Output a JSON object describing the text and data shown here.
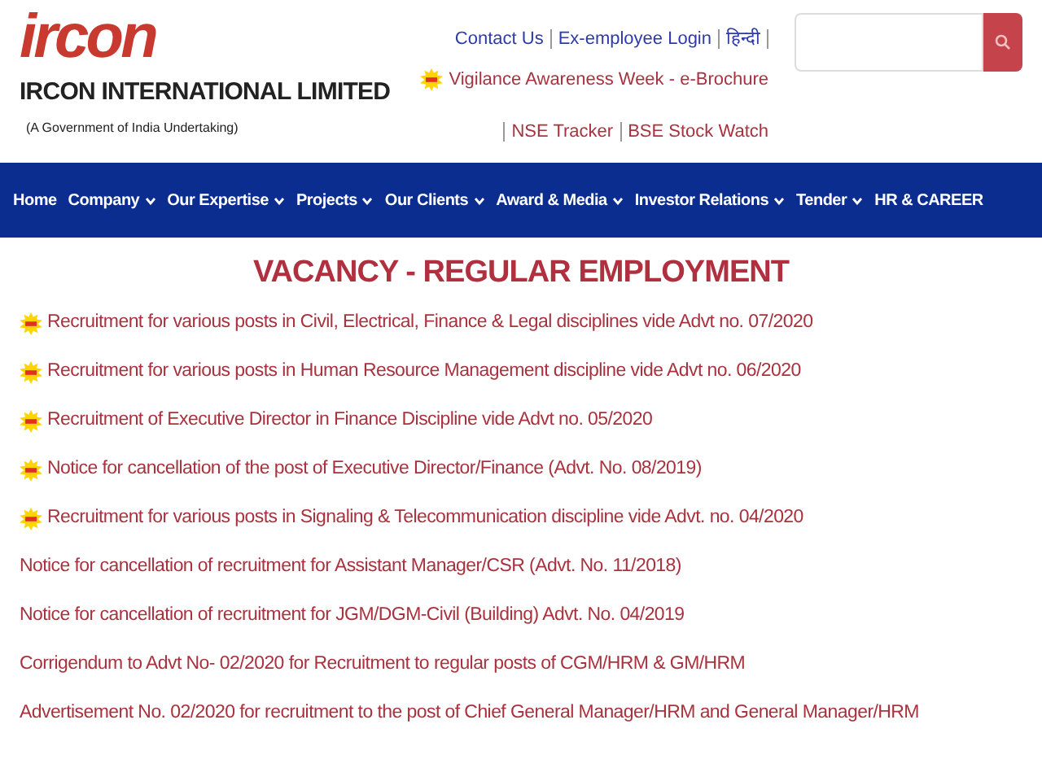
{
  "header": {
    "logo": "ircon",
    "company": "IRCON INTERNATIONAL LIMITED",
    "tagline": "(A Government of India Undertaking)",
    "top_links": [
      {
        "label": "Contact Us"
      },
      {
        "label": "Ex-employee Login"
      },
      {
        "label": "हिन्दी"
      }
    ],
    "vigilance": {
      "label": "Vigilance Awareness Week - e-Brochure",
      "new": true
    },
    "market_links": [
      {
        "label": "NSE Tracker"
      },
      {
        "label": "BSE Stock Watch"
      }
    ]
  },
  "nav": [
    {
      "label": "Home",
      "dropdown": false
    },
    {
      "label": "Company",
      "dropdown": true
    },
    {
      "label": "Our Expertise",
      "dropdown": true
    },
    {
      "label": "Projects",
      "dropdown": true
    },
    {
      "label": "Our Clients",
      "dropdown": true
    },
    {
      "label": "Award & Media",
      "dropdown": true
    },
    {
      "label": "Investor Relations",
      "dropdown": true
    },
    {
      "label": "Tender",
      "dropdown": true
    },
    {
      "label": "HR & CAREER",
      "dropdown": false
    }
  ],
  "title": "VACANCY - REGULAR EMPLOYMENT",
  "vacancies": [
    {
      "text": "Recruitment for various posts in Civil, Electrical, Finance & Legal disciplines vide Advt no. 07/2020",
      "new": true
    },
    {
      "text": "Recruitment for various posts in Human Resource Management discipline vide Advt no. 06/2020",
      "new": true
    },
    {
      "text": "Recruitment of Executive Director in Finance Discipline vide Advt no. 05/2020",
      "new": true
    },
    {
      "text": "Notice for cancellation of the post of Executive Director/Finance (Advt. No. 08/2019)",
      "new": true
    },
    {
      "text": "Recruitment for various posts in Signaling & Telecommunication discipline vide Advt. no. 04/2020",
      "new": true
    },
    {
      "text": "Notice for cancellation of recruitment for Assistant Manager/CSR (Advt. No. 11/2018)",
      "new": false
    },
    {
      "text": "Notice for cancellation of recruitment for JGM/DGM-Civil (Building) Advt. No. 04/2019",
      "new": false
    },
    {
      "text": "Corrigendum to Advt No- 02/2020 for Recruitment to regular posts of CGM/HRM & GM/HRM",
      "new": false
    },
    {
      "text": "Advertisement No. 02/2020 for recruitment to the post of Chief General Manager/HRM and General Manager/HRM",
      "new": false
    }
  ]
}
